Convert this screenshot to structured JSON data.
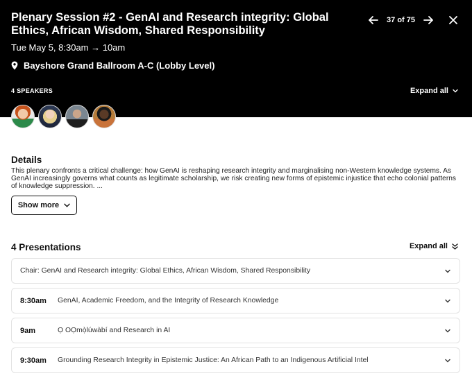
{
  "session": {
    "title": "Plenary Session #2 - GenAI and Research integrity: Global Ethics, African Wisdom, Shared Responsibility",
    "datetime": "Tue May 5, 8:30am → 10am",
    "location": "Bayshore Grand Ballroom A-C (Lobby Level)"
  },
  "pager": {
    "count": "37 of 75",
    "prev_icon": "arrow-left-icon",
    "next_icon": "arrow-right-icon",
    "close_icon": "close-icon"
  },
  "speakers": {
    "label": "4 SPEAKERS",
    "expand_label": "Expand all",
    "avatars": [
      "speaker-1",
      "speaker-2",
      "speaker-3",
      "speaker-4"
    ]
  },
  "details": {
    "heading": "Details",
    "text": "This plenary confronts a critical challenge: how GenAI is reshaping research integrity and marginalising non-Western knowledge systems. As GenAI increasingly governs what counts as legitimate scholarship, we risk creating new forms of epistemic injustice that echo colonial patterns of knowledge suppression. ...",
    "show_more_label": "Show more"
  },
  "presentations": {
    "heading": "4 Presentations",
    "expand_label": "Expand all",
    "items": [
      {
        "time": "",
        "title": "Chair: GenAI and Research integrity: Global Ethics, African Wisdom, Shared Responsibility"
      },
      {
        "time": "8:30am",
        "title": "GenAI, Academic Freedom, and the Integrity of Research Knowledge"
      },
      {
        "time": "9am",
        "title": "Ọ OỌmọ̀lúwàbí and Research in AI"
      },
      {
        "time": "9:30am",
        "title": "Grounding Research Integrity in Epistemic Justice: An African Path to an Indigenous Artificial Intel"
      }
    ]
  },
  "colors": {
    "header_bg": "#000000",
    "header_text": "#ffffff",
    "border": "#e2e2e2"
  }
}
